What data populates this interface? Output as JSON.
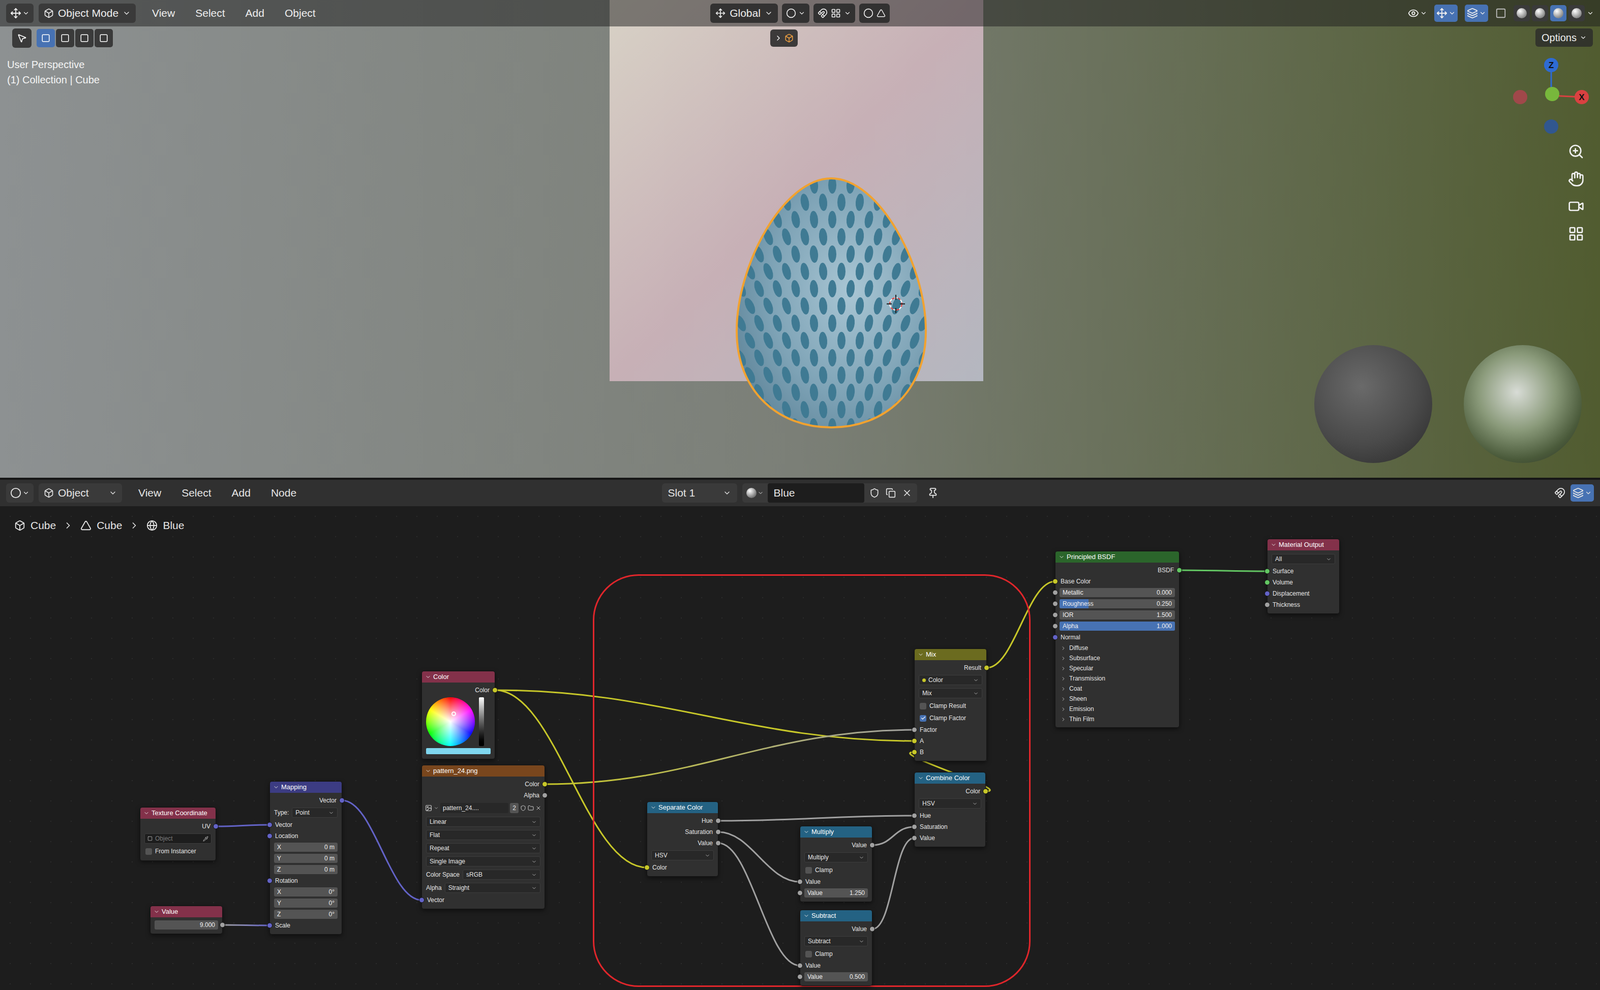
{
  "viewport": {
    "header": {
      "mode": "Object Mode",
      "menus": [
        "View",
        "Select",
        "Add",
        "Object"
      ],
      "orientation": "Global",
      "select_modes": [
        {
          "selected": true
        },
        {
          "selected": false
        },
        {
          "selected": false
        },
        {
          "selected": false
        }
      ],
      "shading_modes": [
        {
          "selected": false
        },
        {
          "selected": false
        },
        {
          "selected": true
        },
        {
          "selected": false
        }
      ]
    },
    "options_button": "Options",
    "info": [
      "User Perspective",
      "(1) Collection | Cube"
    ],
    "gizmo": [
      {
        "label": "Z",
        "color": "#2e6bd3"
      },
      {
        "label": "X",
        "color": "#d94141"
      },
      {
        "color": "#78b83c"
      },
      {
        "color": "#a0484a"
      },
      {
        "color": "#31578f"
      }
    ]
  },
  "node_editor": {
    "header": {
      "context": "Object",
      "menus": [
        "View",
        "Select",
        "Add",
        "Node"
      ],
      "slot": "Slot 1",
      "material": "Blue"
    },
    "breadcrumb": [
      "Cube",
      "Cube",
      "Blue"
    ],
    "nodes": [
      {
        "title": "Texture Coordinate",
        "color": "#83314a",
        "rows": [
          {
            "kind": "output",
            "label": "UV",
            "socket": "#6363c7"
          },
          {
            "kind": "object",
            "placeholder": "Object"
          },
          {
            "kind": "checkbox",
            "label": "From Instancer",
            "checked": false
          }
        ]
      },
      {
        "title": "Value",
        "color": "#83314a",
        "rows": [
          {
            "kind": "field",
            "value": "9.000",
            "socket": "#a1a1a1",
            "side": "right"
          }
        ]
      },
      {
        "title": "Mapping",
        "color": "#3c3c83",
        "rows": [
          {
            "kind": "output",
            "label": "Vector",
            "socket": "#6363c7"
          },
          {
            "kind": "dropdown",
            "label": "Type:",
            "value": "Point"
          },
          {
            "kind": "input",
            "label": "Vector",
            "socket": "#6363c7"
          },
          {
            "kind": "input",
            "label": "Location",
            "socket": "#6363c7"
          },
          {
            "kind": "field",
            "label": "X",
            "value": "0 m"
          },
          {
            "kind": "field",
            "label": "Y",
            "value": "0 m"
          },
          {
            "kind": "field",
            "label": "Z",
            "value": "0 m"
          },
          {
            "kind": "input",
            "label": "Rotation",
            "socket": "#6363c7"
          },
          {
            "kind": "field",
            "label": "X",
            "value": "0°"
          },
          {
            "kind": "field",
            "label": "Y",
            "value": "0°"
          },
          {
            "kind": "field",
            "label": "Z",
            "value": "0°"
          },
          {
            "kind": "input",
            "label": "Scale",
            "socket": "#6363c7"
          }
        ]
      },
      {
        "title": "Color",
        "color": "#83314a",
        "rows": [
          {
            "kind": "output",
            "label": "Color",
            "socket": "#c7c729"
          },
          {
            "kind": "wheel",
            "swatch": "#7fd6ee"
          }
        ]
      },
      {
        "title": "pattern_24.png",
        "color": "#79461d",
        "rows": [
          {
            "kind": "output",
            "label": "Color",
            "socket": "#c7c729"
          },
          {
            "kind": "output",
            "label": "Alpha",
            "socket": "#a1a1a1"
          },
          {
            "kind": "image",
            "file": "pattern_24....",
            "users": "2"
          },
          {
            "kind": "dropdown",
            "value": "Linear"
          },
          {
            "kind": "dropdown",
            "value": "Flat"
          },
          {
            "kind": "dropdown",
            "value": "Repeat"
          },
          {
            "kind": "dropdown",
            "value": "Single Image"
          },
          {
            "kind": "dropdown",
            "label": "Color Space",
            "value": "sRGB"
          },
          {
            "kind": "dropdown",
            "label": "Alpha",
            "value": "Straight"
          },
          {
            "kind": "input",
            "label": "Vector",
            "socket": "#6363c7"
          }
        ]
      },
      {
        "title": "Separate Color",
        "color": "#246283",
        "rows": [
          {
            "kind": "output",
            "label": "Hue",
            "socket": "#a1a1a1"
          },
          {
            "kind": "output",
            "label": "Saturation",
            "socket": "#a1a1a1"
          },
          {
            "kind": "output",
            "label": "Value",
            "socket": "#a1a1a1"
          },
          {
            "kind": "dropdown",
            "value": "HSV"
          },
          {
            "kind": "input",
            "label": "Color",
            "socket": "#c7c729"
          }
        ]
      },
      {
        "title": "Multiply",
        "color": "#246283",
        "rows": [
          {
            "kind": "output",
            "label": "Value",
            "socket": "#a1a1a1"
          },
          {
            "kind": "dropdown",
            "value": "Multiply"
          },
          {
            "kind": "checkbox",
            "label": "Clamp",
            "checked": false
          },
          {
            "kind": "input",
            "label": "Value",
            "socket": "#a1a1a1"
          },
          {
            "kind": "field",
            "label": "Value",
            "value": "1.250",
            "socket": "#a1a1a1",
            "side": "left"
          }
        ]
      },
      {
        "title": "Subtract",
        "color": "#246283",
        "rows": [
          {
            "kind": "output",
            "label": "Value",
            "socket": "#a1a1a1"
          },
          {
            "kind": "dropdown",
            "value": "Subtract"
          },
          {
            "kind": "checkbox",
            "label": "Clamp",
            "checked": false
          },
          {
            "kind": "input",
            "label": "Value",
            "socket": "#a1a1a1"
          },
          {
            "kind": "field",
            "label": "Value",
            "value": "0.500",
            "socket": "#a1a1a1",
            "side": "left"
          }
        ]
      },
      {
        "title": "Combine Color",
        "color": "#246283",
        "rows": [
          {
            "kind": "output",
            "label": "Color",
            "socket": "#c7c729"
          },
          {
            "kind": "dropdown",
            "value": "HSV"
          },
          {
            "kind": "input",
            "label": "Hue",
            "socket": "#a1a1a1"
          },
          {
            "kind": "input",
            "label": "Saturation",
            "socket": "#a1a1a1"
          },
          {
            "kind": "input",
            "label": "Value",
            "socket": "#a1a1a1"
          }
        ]
      },
      {
        "title": "Mix",
        "color": "#6b6b1f",
        "rows": [
          {
            "kind": "output",
            "label": "Result",
            "socket": "#c7c729"
          },
          {
            "kind": "dropdown",
            "value": "Color",
            "dot": "#c7c729"
          },
          {
            "kind": "dropdown",
            "value": "Mix"
          },
          {
            "kind": "checkbox",
            "label": "Clamp Result",
            "checked": false
          },
          {
            "kind": "checkbox",
            "label": "Clamp Factor",
            "checked": true
          },
          {
            "kind": "input",
            "label": "Factor",
            "socket": "#a1a1a1"
          },
          {
            "kind": "input",
            "label": "A",
            "socket": "#c7c729"
          },
          {
            "kind": "input",
            "label": "B",
            "socket": "#c7c729"
          }
        ]
      },
      {
        "title": "Principled BSDF",
        "color": "#2b652b",
        "rows": [
          {
            "kind": "output",
            "label": "BSDF",
            "socket": "#63c763"
          },
          {
            "kind": "input",
            "label": "Base Color",
            "socket": "#c7c729"
          },
          {
            "kind": "field",
            "label": "Metallic",
            "value": "0.000",
            "level": 0,
            "socket": "#a1a1a1",
            "side": "left"
          },
          {
            "kind": "field",
            "label": "Roughness",
            "value": "0.250",
            "level": 0.25,
            "socket": "#a1a1a1",
            "side": "left"
          },
          {
            "kind": "field",
            "label": "IOR",
            "value": "1.500",
            "socket": "#a1a1a1",
            "side": "left"
          },
          {
            "kind": "field",
            "label": "Alpha",
            "value": "1.000",
            "level": 1,
            "socket": "#a1a1a1",
            "side": "left"
          },
          {
            "kind": "input",
            "label": "Normal",
            "socket": "#6363c7"
          },
          {
            "kind": "panel",
            "label": "Diffuse"
          },
          {
            "kind": "panel",
            "label": "Subsurface"
          },
          {
            "kind": "panel",
            "label": "Specular"
          },
          {
            "kind": "panel",
            "label": "Transmission"
          },
          {
            "kind": "panel",
            "label": "Coat"
          },
          {
            "kind": "panel",
            "label": "Sheen"
          },
          {
            "kind": "panel",
            "label": "Emission"
          },
          {
            "kind": "panel",
            "label": "Thin Film"
          }
        ]
      },
      {
        "title": "Material Output",
        "color": "#83314a",
        "rows": [
          {
            "kind": "dropdown",
            "value": "All"
          },
          {
            "kind": "input",
            "label": "Surface",
            "socket": "#63c763"
          },
          {
            "kind": "input",
            "label": "Volume",
            "socket": "#63c763"
          },
          {
            "kind": "input",
            "label": "Displacement",
            "socket": "#6363c7"
          },
          {
            "kind": "input",
            "label": "Thickness",
            "socket": "#a1a1a1"
          }
        ]
      }
    ]
  }
}
